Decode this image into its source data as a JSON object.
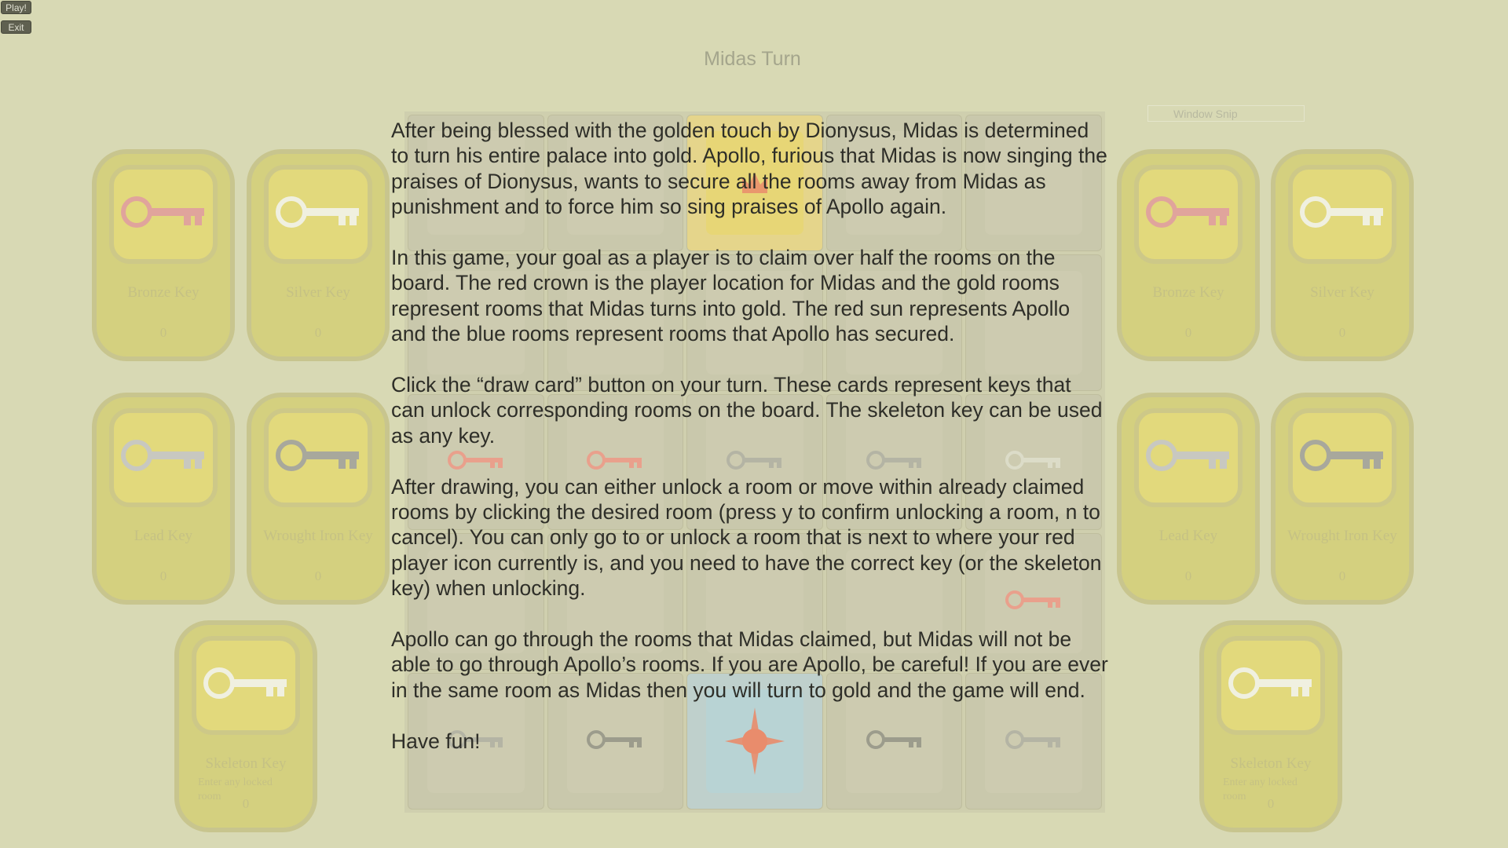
{
  "buttons": {
    "play": "Play!",
    "exit": "Exit"
  },
  "turn_title": "Midas Turn",
  "window_snip_label": "Window Snip",
  "colors": {
    "background": "#d8d9b4",
    "bronze": "#e0a49c",
    "silver": "#f0f0e0",
    "lead": "#c8c8c0",
    "wrought_iron": "#a8a89c",
    "midas_gold_room": "#e7d676",
    "apollo_blue_room": "#b8d3d4",
    "red_accent": "#e98c6c"
  },
  "left_cards": [
    {
      "name": "Bronze Key",
      "count": "0",
      "icon": "bronze-key-icon"
    },
    {
      "name": "Silver Key",
      "count": "0",
      "icon": "silver-key-icon"
    },
    {
      "name": "Lead Key",
      "count": "0",
      "icon": "lead-key-icon"
    },
    {
      "name": "Wrought Iron Key",
      "count": "0",
      "icon": "wrought-iron-key-icon"
    },
    {
      "name": "Skeleton Key",
      "desc": "Enter any locked room",
      "count": "0",
      "icon": "skeleton-key-icon"
    }
  ],
  "right_cards": [
    {
      "name": "Bronze Key",
      "count": "0",
      "icon": "bronze-key-icon"
    },
    {
      "name": "Silver Key",
      "count": "0",
      "icon": "silver-key-icon"
    },
    {
      "name": "Lead Key",
      "count": "0",
      "icon": "lead-key-icon"
    },
    {
      "name": "Wrought Iron Key",
      "count": "0",
      "icon": "wrought-iron-key-icon"
    },
    {
      "name": "Skeleton Key",
      "desc": "Enter any locked room",
      "count": "0",
      "icon": "skeleton-key-icon"
    }
  ],
  "board": {
    "midas_icon": "crown-icon",
    "apollo_icon": "sun-icon"
  },
  "instructions": {
    "p1": "After being blessed with the golden touch by Dionysus, Midas is determined to turn his entire palace into gold. Apollo, furious that Midas is now singing the praises of Dionysus, wants to secure all the rooms away from Midas as punishment and to force him so sing praises of Apollo again.",
    "p2": "In this game, your goal as a player is to claim over half the rooms on the board. The red crown is the player location for Midas and the gold rooms represent rooms that Midas turns into gold. The red sun represents Apollo and the blue rooms represent rooms that Apollo has secured.",
    "p3": "Click the “draw card” button on your turn. These cards represent keys that can unlock corresponding rooms on the board. The skeleton key can be used as any key.",
    "p4": "After drawing, you can either unlock a room or move within already claimed rooms by clicking the desired room (press y to confirm unlocking a room, n to cancel). You can only go to or unlock a room that is next to where your red player icon currently is, and you need to have the correct key (or the skeleton key) when unlocking.",
    "p5": "Apollo can go through the rooms that Midas claimed, but Midas will not be able to go through Apollo’s rooms. If you are Apollo, be careful! If you are ever in the same room as Midas then you will turn to gold and the game will end.",
    "p6": "Have fun!"
  }
}
